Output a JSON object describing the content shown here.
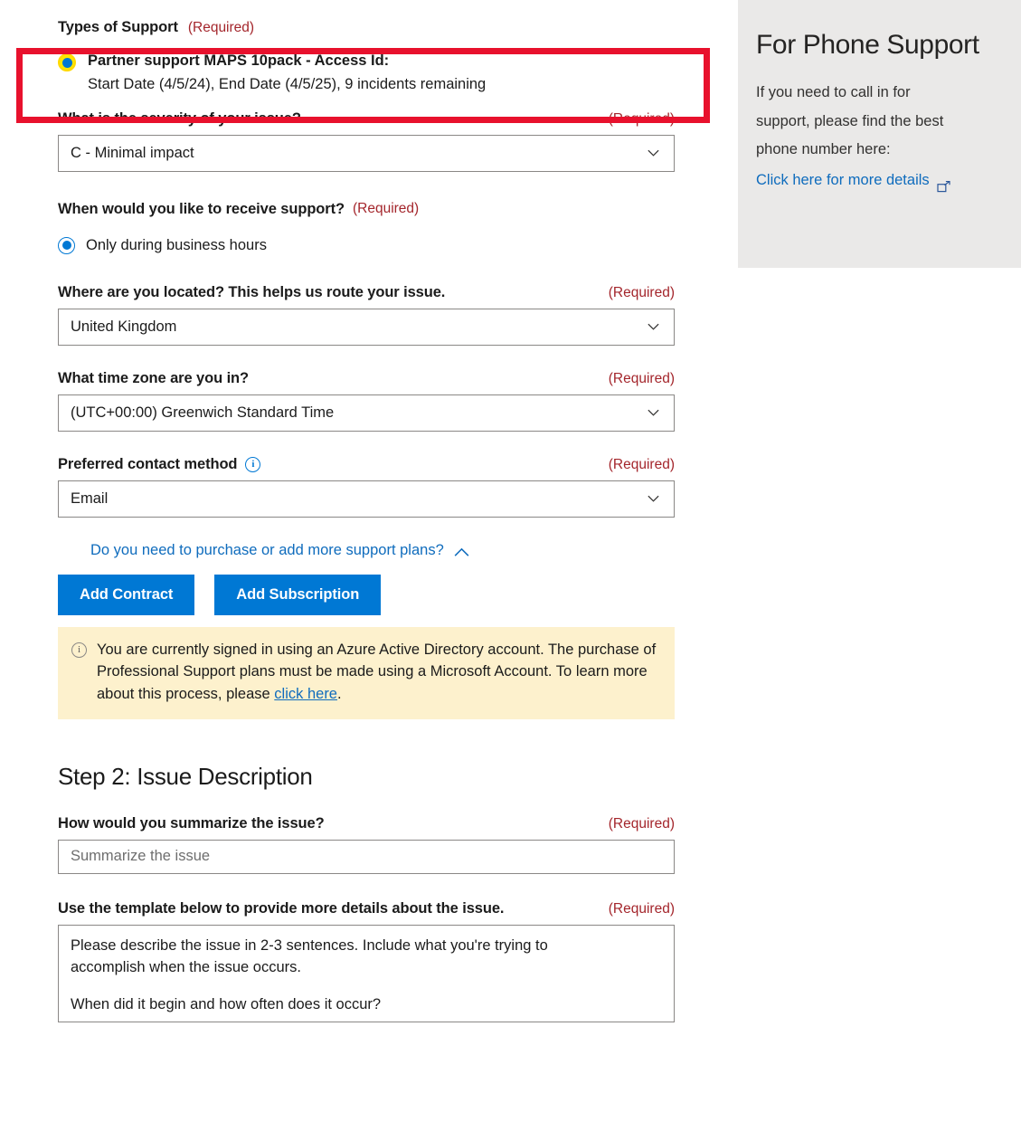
{
  "form": {
    "types_of_support": {
      "label": "Types of Support",
      "required": "(Required)",
      "plan": {
        "title": "Partner support MAPS 10pack - Access Id:",
        "details": "Start Date (4/5/24), End Date (4/5/25), 9 incidents remaining",
        "selected": true
      }
    },
    "severity": {
      "label": "What is the severity of your issue?",
      "required": "(Required)",
      "value": "C - Minimal impact"
    },
    "when_support": {
      "label": "When would you like to receive support?",
      "required": "(Required)",
      "option": "Only during business hours"
    },
    "location": {
      "label": "Where are you located? This helps us route your issue.",
      "required": "(Required)",
      "value": "United Kingdom"
    },
    "timezone": {
      "label": "What time zone are you in?",
      "required": "(Required)",
      "value": "(UTC+00:00) Greenwich Standard Time"
    },
    "contact_method": {
      "label": "Preferred contact method",
      "required": "(Required)",
      "value": "Email",
      "info_icon": "info-circle-icon"
    },
    "purchase": {
      "link_text": "Do you need to purchase or add more support plans?",
      "chevron": "chevron-up-icon",
      "add_contract_label": "Add Contract",
      "add_subscription_label": "Add Subscription"
    },
    "alert": {
      "icon": "info-circle-icon",
      "text_before": "You are currently signed in using an Azure Active Directory account. The purchase of Professional Support plans must be made using a Microsoft Account. To learn more about this process, please ",
      "link_text": "click here",
      "text_after": "."
    }
  },
  "step2": {
    "title": "Step 2: Issue Description",
    "summary": {
      "label": "How would you summarize the issue?",
      "required": "(Required)",
      "placeholder": "Summarize the issue",
      "value": ""
    },
    "details": {
      "label": "Use the template below to provide more details about the issue.",
      "required": "(Required)",
      "line1": "Please describe the issue in 2-3 sentences. Include what you're trying to",
      "line2": "accomplish when the issue occurs.",
      "line3": "When did it begin and how often does it occur?"
    }
  },
  "side_panel": {
    "title": "For Phone Support",
    "line1": "If you need to call in for",
    "line2": "support, please find the best",
    "line3": "phone number here:",
    "link_text": "Click here for more details",
    "link_icon": "external-link-icon"
  },
  "colors": {
    "accent_blue": "#0078d4",
    "link_blue": "#0f6cbd",
    "required_red": "#a4262c",
    "highlight_red": "#e8112d",
    "highlight_yellow": "#ffe600",
    "alert_yellow": "#fdf1cd",
    "panel_gray": "#eae9e8"
  }
}
